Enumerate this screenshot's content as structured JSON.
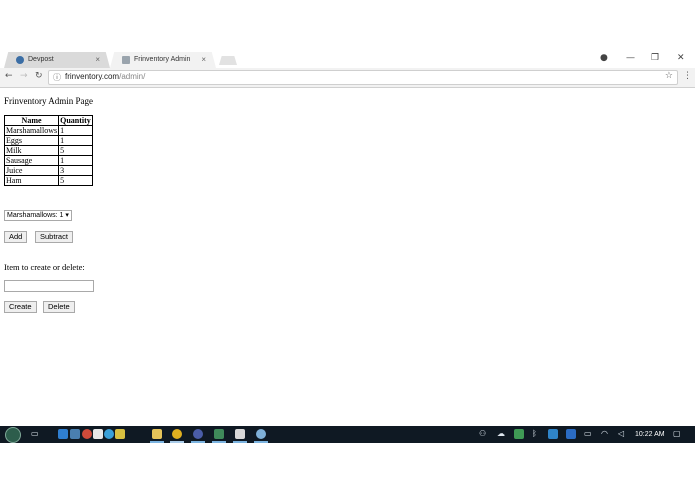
{
  "browser": {
    "tabs": [
      {
        "label": "Devpost",
        "active": false
      },
      {
        "label": "Frinventory Admin",
        "active": true
      }
    ],
    "url_host": "frinventory.com",
    "url_path": "/admin/"
  },
  "icons": {
    "back": "←",
    "forward": "→",
    "reload": "↻",
    "info": "ⓘ",
    "star": "☆",
    "menu": "⋮",
    "profile": "●",
    "minimize": "—",
    "restore": "❐",
    "close": "✕",
    "tab_close": "×"
  },
  "page": {
    "title": "Frinventory Admin Page",
    "table": {
      "headers": [
        "Name",
        "Quantity"
      ],
      "rows": [
        [
          "Marshamallows",
          "1"
        ],
        [
          "Eggs",
          "1"
        ],
        [
          "Milk",
          "5"
        ],
        [
          "Sausage",
          "1"
        ],
        [
          "Juice",
          "3"
        ],
        [
          "Ham",
          "5"
        ]
      ]
    },
    "select_value": "Marshamallows: 1",
    "add_label": "Add",
    "subtract_label": "Subtract",
    "prompt": "Item to create or delete:",
    "item_input_value": "",
    "create_label": "Create",
    "delete_label": "Delete"
  },
  "taskbar": {
    "clock": "10:22 AM"
  },
  "colors": {
    "taskbar_bg": "#0f1923",
    "tab_active": "#f2f2f2",
    "tab_inactive": "#dadada"
  }
}
